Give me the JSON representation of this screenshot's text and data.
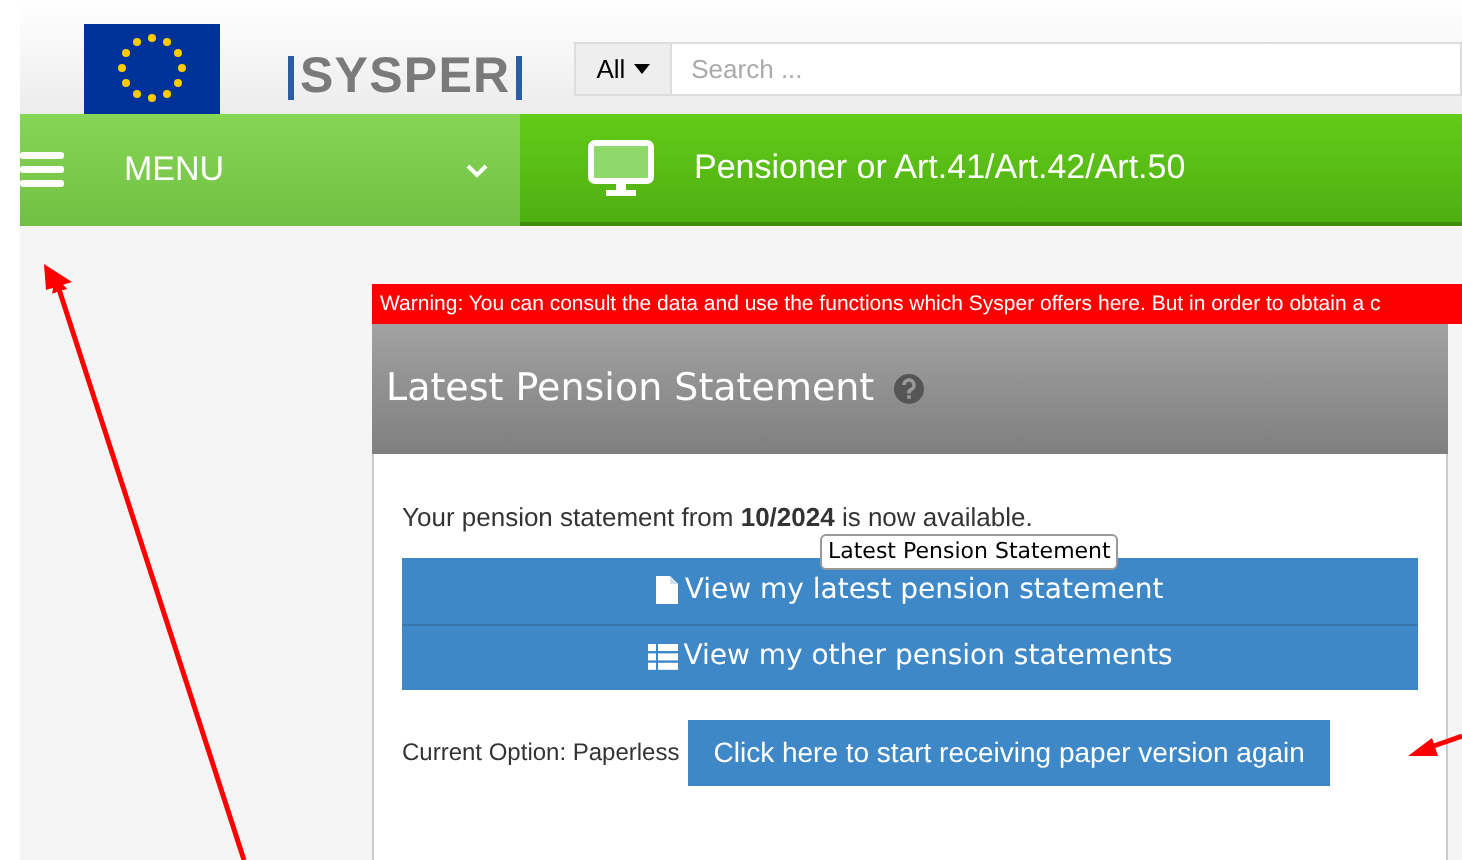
{
  "header": {
    "logo": "SYSPER",
    "search": {
      "scope": "All",
      "placeholder": "Search ..."
    }
  },
  "nav": {
    "menu_label": "MENU",
    "profile": "Pensioner or Art.41/Art.42/Art.50"
  },
  "warning": "Warning: You can consult the data and use the functions which Sysper offers here. But in order to obtain a c",
  "panel": {
    "title": "Latest Pension Statement",
    "message": "Your pension statement from **10/2024** is now available.",
    "tooltip": "Latest Pension Statement",
    "buttons": [
      {
        "kind": "file",
        "label": "View my latest pension statement"
      },
      {
        "kind": "list",
        "label": "View my other pension statements"
      }
    ],
    "current_option": "Current Option: Paperless",
    "paper_button": "Click here to start receiving paper version again"
  }
}
